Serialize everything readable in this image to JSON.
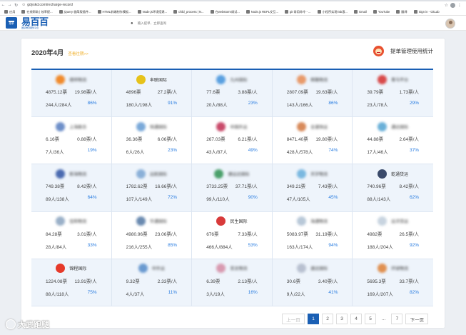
{
  "browser": {
    "url": "gdyskd.com/recharge-record",
    "bookmarks": [
      "应用",
      "在线帮助 | 效率提...",
      "jQuery 极简版插件...",
      "HTML前端制作模板...",
      "Node.js环境搭建...",
      "child_process | N...",
      "在webstorm调试...",
      "Node.js REPL交互...",
      "git 常用命令 - ...",
      "小程序实现Tab滚...",
      "Gmail",
      "YouTube",
      "翻译",
      "Sign in - GitLab"
    ]
  },
  "header": {
    "menu_label": "菜单",
    "logo_text": "易百百",
    "logo_sub": "国际物流服务平台",
    "search_placeholder": "输入提单、立即查询"
  },
  "section": {
    "month": "2020年4月",
    "view_past": "查看往期>>",
    "stat_title": "提单管理使用统计"
  },
  "brands": [
    {
      "name": "德邦物流",
      "color": "#f08a2c",
      "blur": true,
      "votes": "4875.12票",
      "avg": "19.98票/人",
      "people": "244人/284人",
      "pct": "86%"
    },
    {
      "name": "丰联国际",
      "color": "#e6c21a",
      "blur": false,
      "votes": "4896票",
      "avg": "27.2票/人",
      "people": "180人/198人",
      "pct": "91%"
    },
    {
      "name": "九州国际",
      "color": "#5aa0e0",
      "blur": true,
      "votes": "77.6票",
      "avg": "3.88票/人",
      "people": "20人/88人",
      "pct": "23%"
    },
    {
      "name": "顺路物流",
      "color": "#e89a6a",
      "blur": true,
      "votes": "2807.09票",
      "avg": "19.63票/人",
      "people": "143人/166人",
      "pct": "86%"
    },
    {
      "name": "青马平台",
      "color": "#d84a4a",
      "blur": true,
      "votes": "39.79票",
      "avg": "1.73票/人",
      "people": "23人/78人",
      "pct": "29%"
    },
    {
      "name": "上海联合",
      "color": "#6e8fc9",
      "blur": true,
      "votes": "6.16票",
      "avg": "0.88票/人",
      "people": "7人/36人",
      "pct": "19%"
    },
    {
      "name": "恒通国际",
      "color": "#7aa9d9",
      "blur": true,
      "votes": "36.36票",
      "avg": "6.06票/人",
      "people": "6人/26人",
      "pct": "23%"
    },
    {
      "name": "中国外运",
      "color": "#c94a6a",
      "blur": true,
      "votes": "267.03票",
      "avg": "6.21票/人",
      "people": "43人/87人",
      "pct": "49%"
    },
    {
      "name": "全速快运",
      "color": "#d88a5a",
      "blur": true,
      "votes": "8471.40票",
      "avg": "19.80票/人",
      "people": "428人/578人",
      "pct": "74%"
    },
    {
      "name": "通达国际",
      "color": "#6ab0d8",
      "blur": true,
      "votes": "44.88票",
      "avg": "2.64票/人",
      "people": "17人/46人",
      "pct": "37%"
    },
    {
      "name": "新海物流",
      "color": "#4a6ab0",
      "blur": true,
      "votes": "749.38票",
      "avg": "8.42票/人",
      "people": "89人/138人",
      "pct": "64%"
    },
    {
      "name": "远航国际",
      "color": "#8ab0d8",
      "blur": true,
      "votes": "1782.62票",
      "avg": "16.66票/人",
      "people": "107人/149人",
      "pct": "72%"
    },
    {
      "name": "捷运达国际",
      "color": "#4aa06a",
      "blur": true,
      "votes": "3733.25票",
      "avg": "37.71票/人",
      "people": "99人/110人",
      "pct": "90%"
    },
    {
      "name": "天宇物流",
      "color": "#7ab8e0",
      "blur": true,
      "votes": "349.21票",
      "avg": "7.43票/人",
      "people": "47人/105人",
      "pct": "45%"
    },
    {
      "name": "乾通货运",
      "color": "#3a4a6a",
      "blur": false,
      "votes": "740.96票",
      "avg": "8.42票/人",
      "people": "88人/143人",
      "pct": "62%"
    },
    {
      "name": "佳和物流",
      "color": "#9ab0c8",
      "blur": true,
      "votes": "84.28票",
      "avg": "3.01票/人",
      "people": "28人/84人",
      "pct": "33%"
    },
    {
      "name": "华通国际",
      "color": "#6a8ab0",
      "blur": true,
      "votes": "4980.96票",
      "avg": "23.06票/人",
      "people": "216人/255人",
      "pct": "85%"
    },
    {
      "name": "民生国际",
      "color": "#d83a3a",
      "blur": false,
      "votes": "676票",
      "avg": "7.33票/人",
      "people": "466人/884人",
      "pct": "53%"
    },
    {
      "name": "海通物流",
      "color": "#b8c8d8",
      "blur": true,
      "votes": "5083.97票",
      "avg": "31.19票/人",
      "people": "163人/174人",
      "pct": "94%"
    },
    {
      "name": "远洋货运",
      "color": "#c8d4e0",
      "blur": true,
      "votes": "4982票",
      "avg": "26.5票/人",
      "people": "188人/204人",
      "pct": "92%"
    },
    {
      "name": "锦程国际",
      "color": "#e63a2a",
      "blur": false,
      "votes": "1224.08票",
      "avg": "13.91票/人",
      "people": "88人/118人",
      "pct": "75%"
    },
    {
      "name": "中外运",
      "color": "#6a9ad0",
      "blur": true,
      "votes": "9.32票",
      "avg": "2.33票/人",
      "people": "4人/37人",
      "pct": "11%"
    },
    {
      "name": "亚太物流",
      "color": "#d89ab0",
      "blur": true,
      "votes": "6.39票",
      "avg": "2.13票/人",
      "people": "3人/19人",
      "pct": "16%"
    },
    {
      "name": "速达国际",
      "color": "#b8c0d0",
      "blur": true,
      "votes": "30.6票",
      "avg": "3.40票/人",
      "people": "9人/22人",
      "pct": "41%"
    },
    {
      "name": "环球物流",
      "color": "#e09050",
      "blur": true,
      "votes": "5695.3票",
      "avg": "33.7票/人",
      "people": "169人/207人",
      "pct": "82%"
    }
  ],
  "pagination": {
    "prev": "上一页",
    "pages": [
      "1",
      "2",
      "3",
      "4",
      "5"
    ],
    "ellipsis": "...",
    "last": "7",
    "next": "下一页",
    "current": "1"
  },
  "watermark": "大武跑腿",
  "colors": {
    "primary": "#1a5fb4",
    "accent": "#f0b12c",
    "percent": "#2a7de1"
  }
}
